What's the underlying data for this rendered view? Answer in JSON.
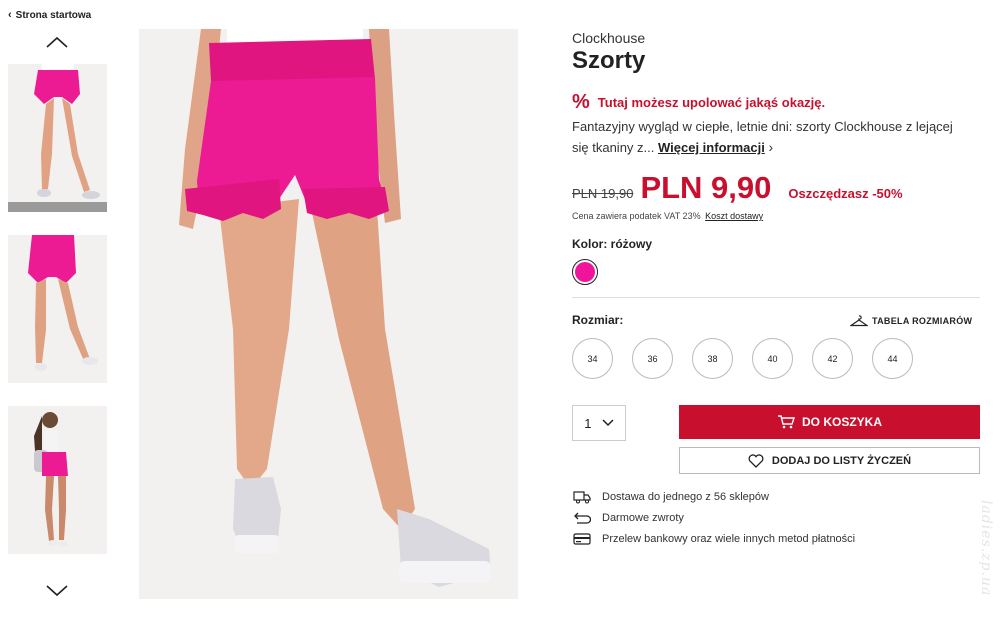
{
  "breadcrumb": {
    "back_label": "Strona startowa"
  },
  "gallery": {
    "thumbnails": [
      {
        "alt": "thumbnail-front-legs",
        "active": true
      },
      {
        "alt": "thumbnail-back-legs",
        "active": false
      },
      {
        "alt": "thumbnail-full-body",
        "active": false
      }
    ],
    "up_icon": "chevron-up-icon",
    "down_icon": "chevron-down-icon"
  },
  "product": {
    "brand": "Clockhouse",
    "title": "Szorty",
    "deal_text": "Tutaj możesz upolować jakąś okazję.",
    "deal_icon": "%",
    "description": "Fantazyjny wygląd w ciepłe, letnie dni: szorty Clockhouse z lejącej się tkaniny z...",
    "more_info": "Więcej informacji",
    "old_price": "PLN 19,90",
    "new_price": "PLN 9,90",
    "savings": "Oszczędzasz -50%",
    "tax_note": "Cena zawiera podatek VAT 23%",
    "shipping_link": "Koszt dostawy",
    "color_label": "Kolor: różowy",
    "color_hex": "#f0149b",
    "size_label": "Rozmiar:",
    "size_chart": "TABELA ROZMIARÓW",
    "sizes": [
      "34",
      "36",
      "38",
      "40",
      "42",
      "44"
    ],
    "quantity": "1",
    "add_to_cart": "DO KOSZYKA",
    "add_to_wishlist": "DODAJ DO LISTY ŻYCZEŃ"
  },
  "features": [
    {
      "icon": "truck-icon",
      "text": "Dostawa do jednego z 56 sklepów"
    },
    {
      "icon": "return-arrow-icon",
      "text": "Darmowe zwroty"
    },
    {
      "icon": "credit-card-icon",
      "text": "Przelew bankowy oraz wiele innych metod płatności"
    }
  ],
  "colors": {
    "accent": "#c8102e",
    "swatch": "#f0149b",
    "skin": "#e3a88a",
    "shoe": "#d9d9df"
  },
  "watermark": "ladies.zp.ua"
}
